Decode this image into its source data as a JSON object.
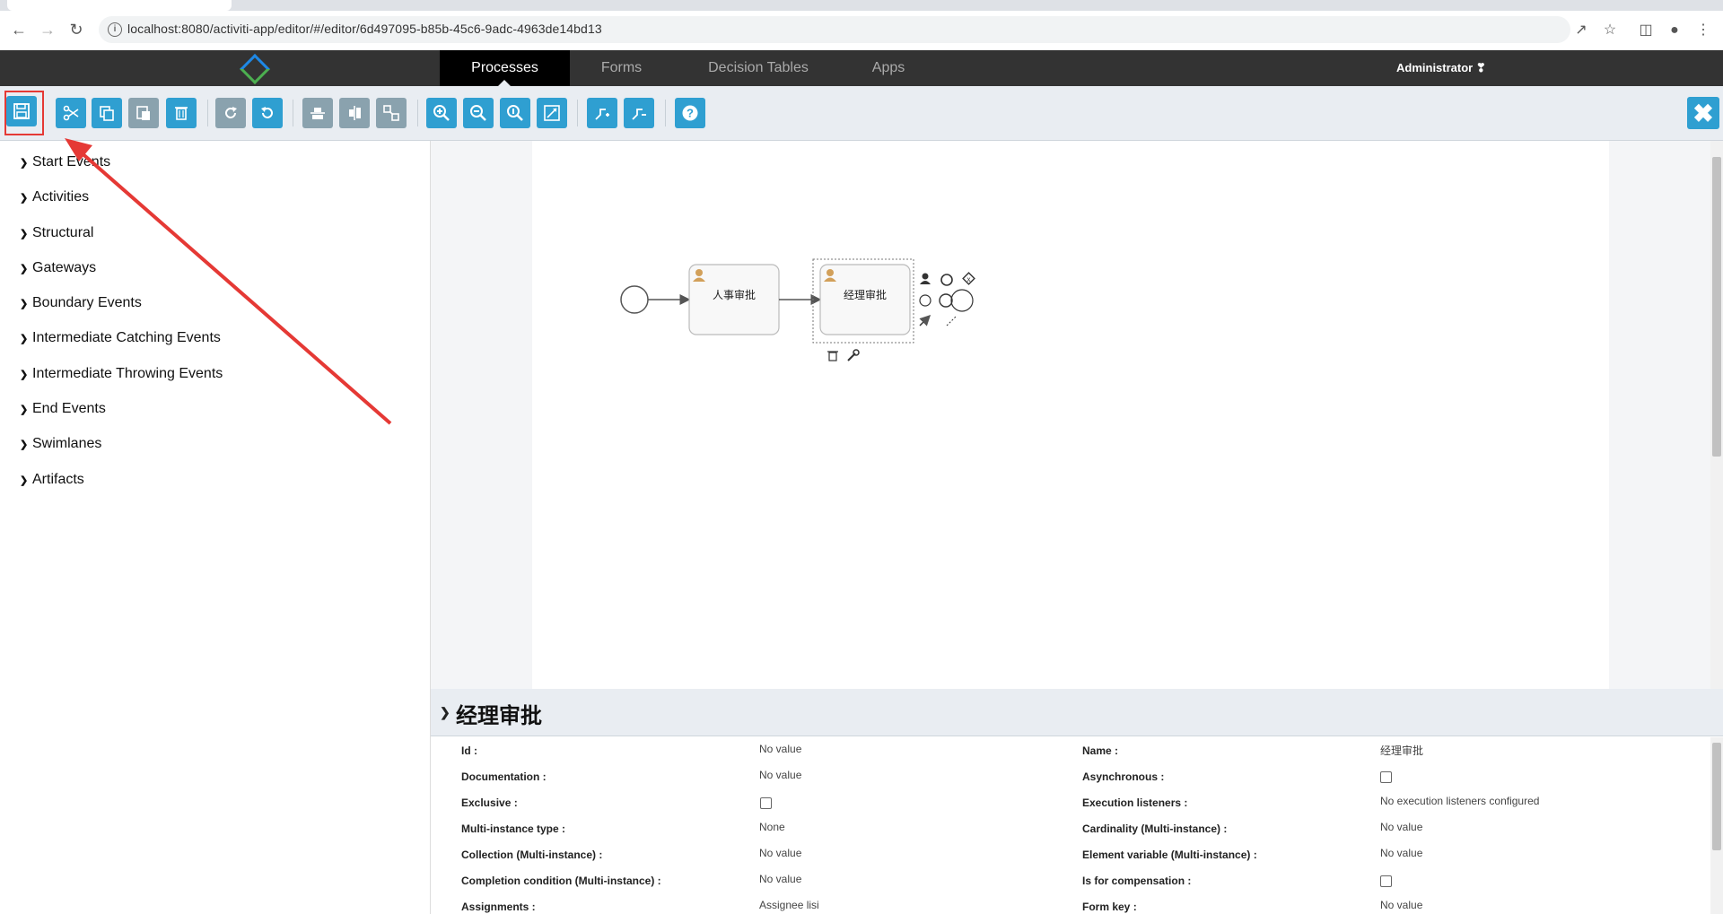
{
  "browser": {
    "url": "localhost:8080/activiti-app/editor/#/editor/6d497095-b85b-45c6-9adc-4963de14bd13"
  },
  "nav": {
    "tabs": [
      "Processes",
      "Forms",
      "Decision Tables",
      "Apps"
    ],
    "active_tab": "Processes",
    "user": "Administrator ❣"
  },
  "palette": {
    "items": [
      "Start Events",
      "Activities",
      "Structural",
      "Gateways",
      "Boundary Events",
      "Intermediate Catching Events",
      "Intermediate Throwing Events",
      "End Events",
      "Swimlanes",
      "Artifacts"
    ]
  },
  "diagram": {
    "task1": "人事审批",
    "task2": "经理审批"
  },
  "properties": {
    "title": "经理审批",
    "rows": [
      {
        "l1": "Id :",
        "v1": "No value",
        "l2": "Name :",
        "v2": "经理审批"
      },
      {
        "l1": "Documentation :",
        "v1": "No value",
        "l2": "Asynchronous :",
        "v2": ""
      },
      {
        "l1": "Exclusive :",
        "v1": "",
        "l2": "Execution listeners :",
        "v2": "No execution listeners configured"
      },
      {
        "l1": "Multi-instance type :",
        "v1": "None",
        "l2": "Cardinality (Multi-instance) :",
        "v2": "No value"
      },
      {
        "l1": "Collection (Multi-instance) :",
        "v1": "No value",
        "l2": "Element variable (Multi-instance) :",
        "v2": "No value"
      },
      {
        "l1": "Completion condition (Multi-instance) :",
        "v1": "No value",
        "l2": "Is for compensation :",
        "v2": ""
      },
      {
        "l1": "Assignments :",
        "v1": "Assignee lisi",
        "l2": "Form key :",
        "v2": "No value"
      }
    ]
  },
  "colors": {
    "toolbar_button": "#2f9fd1",
    "toolbar_button_disabled": "#8aa2ae",
    "nav_bg": "#333333",
    "highlight": "#e53935"
  }
}
